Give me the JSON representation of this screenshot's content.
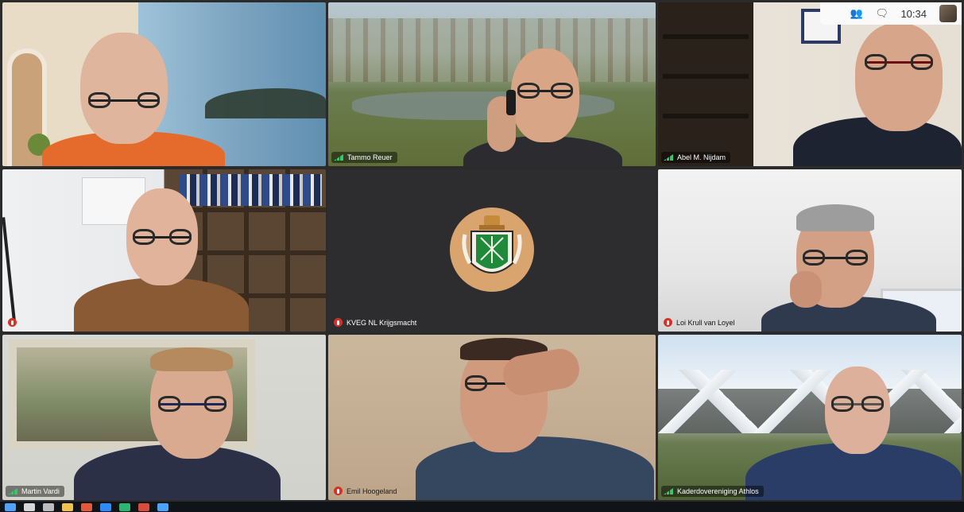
{
  "system": {
    "clock": "10:34"
  },
  "participants": [
    {
      "name": ""
    },
    {
      "name": "Tammo Reuer"
    },
    {
      "name": "Abel M. Nijdam"
    },
    {
      "name": ""
    },
    {
      "name": "KVEG NL Krijgsmacht"
    },
    {
      "name": "Loi Krull van Loyel"
    },
    {
      "name": "Martin Vardi"
    },
    {
      "name": "Emil Hoogeland"
    },
    {
      "name": "Kaderdovereniging Athlos"
    }
  ],
  "icons": {
    "top": [
      "people-icon",
      "chat-icon",
      "self-view-thumbnail"
    ],
    "mic_muted": "mic-muted-icon",
    "signal": "signal-icon"
  },
  "colors": {
    "mic_muted": "#d93025",
    "emblem": "#d9a46e",
    "emblem_shield": "#1f8a3a",
    "taskbar": "#101418"
  }
}
